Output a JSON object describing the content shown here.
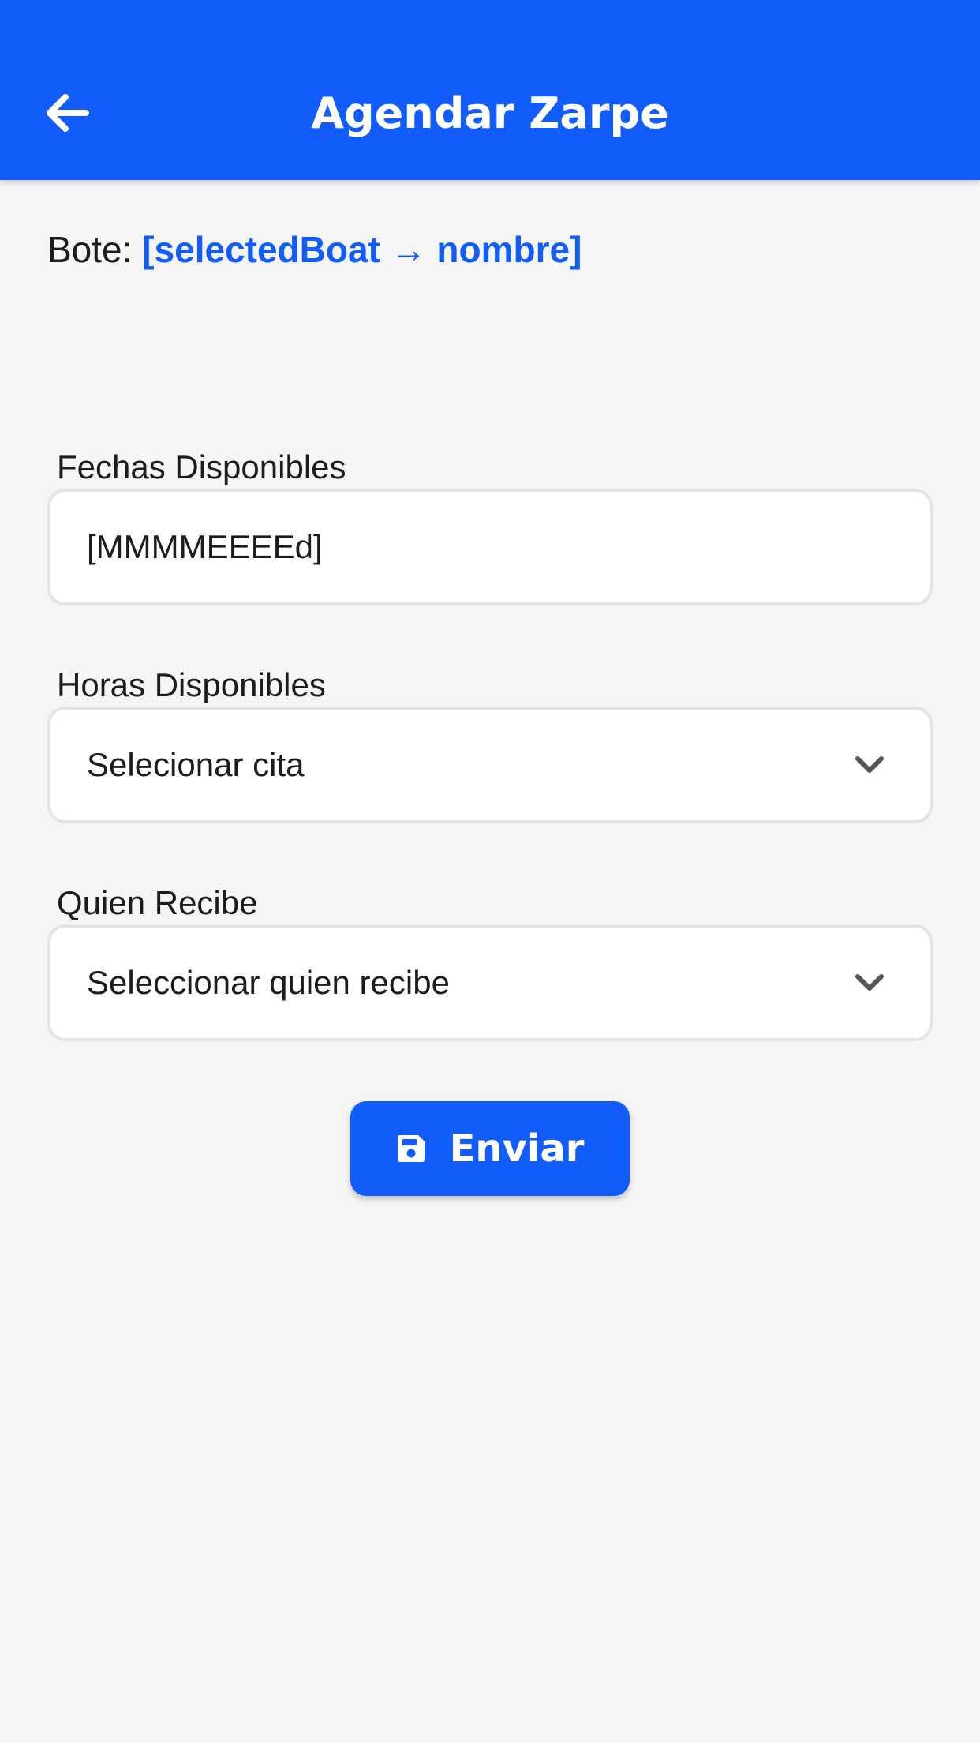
{
  "header": {
    "title": "Agendar Zarpe",
    "back_icon": "arrow-left-icon",
    "background_color": "#125cfb"
  },
  "boat": {
    "label": "Bote:",
    "value": "[selectedBoat → nombre]",
    "value_color": "#125cfb"
  },
  "fields": {
    "fechas": {
      "label": "Fechas Disponibles",
      "value": "[MMMMEEEEd]"
    },
    "horas": {
      "label": "Horas Disponibles",
      "placeholder": "Selecionar cita",
      "icon": "chevron-down-icon"
    },
    "recibe": {
      "label": "Quien Recibe",
      "placeholder": "Seleccionar quien recibe",
      "icon": "chevron-down-icon"
    }
  },
  "submit": {
    "label": "Enviar",
    "icon": "save-icon"
  }
}
